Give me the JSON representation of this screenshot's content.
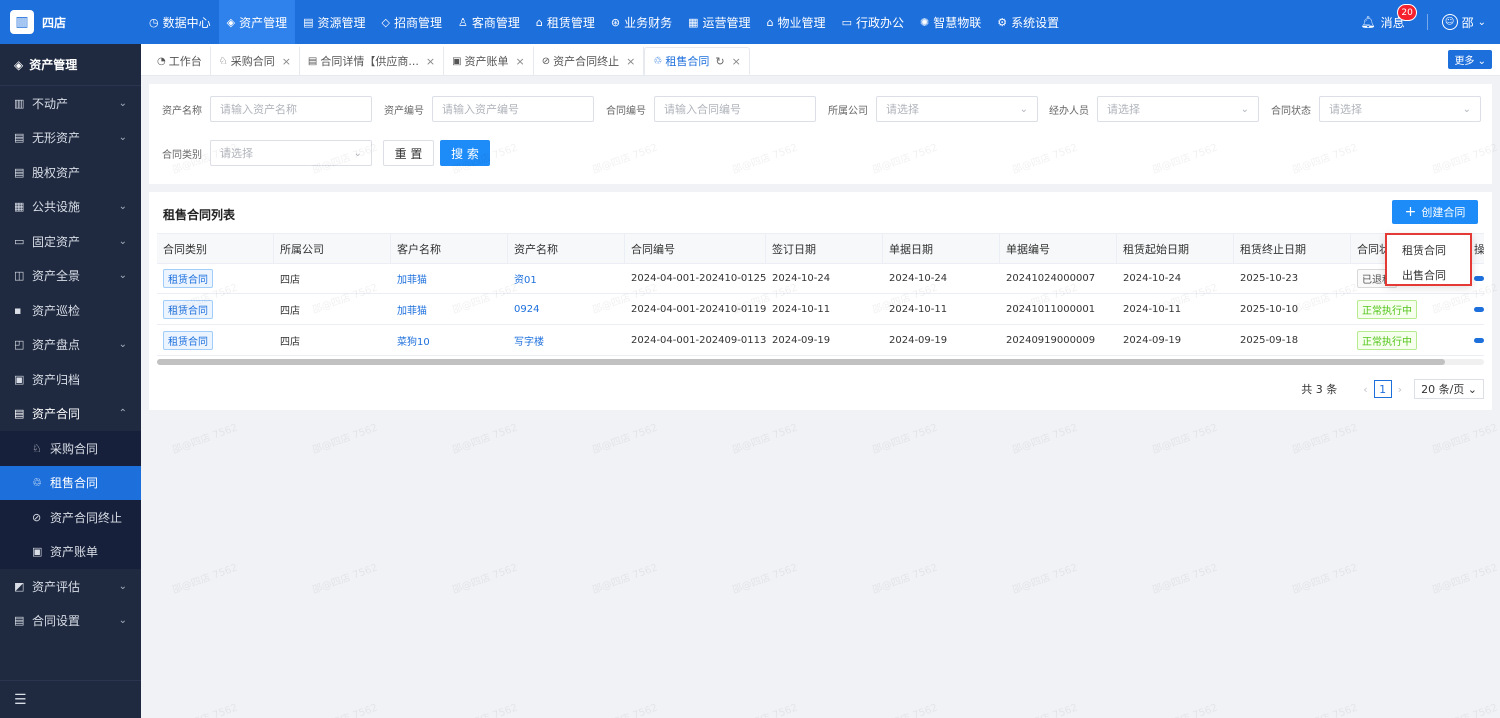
{
  "brand": {
    "name": "四店"
  },
  "topnav": [
    {
      "label": "数据中心",
      "icon": "dashboard-icon",
      "glyph": "◷"
    },
    {
      "label": "资产管理",
      "icon": "cube-icon",
      "glyph": "◈",
      "active": true
    },
    {
      "label": "资源管理",
      "icon": "building-icon",
      "glyph": "▤"
    },
    {
      "label": "招商管理",
      "icon": "tag-icon",
      "glyph": "◇"
    },
    {
      "label": "客商管理",
      "icon": "users-icon",
      "glyph": "♙"
    },
    {
      "label": "租赁管理",
      "icon": "house-icon",
      "glyph": "⌂"
    },
    {
      "label": "业务财务",
      "icon": "yen-icon",
      "glyph": "⊛"
    },
    {
      "label": "运营管理",
      "icon": "grid-icon",
      "glyph": "▦"
    },
    {
      "label": "物业管理",
      "icon": "home-icon",
      "glyph": "⌂"
    },
    {
      "label": "行政办公",
      "icon": "monitor-icon",
      "glyph": "▭"
    },
    {
      "label": "智慧物联",
      "icon": "iot-icon",
      "glyph": "✺"
    },
    {
      "label": "系统设置",
      "icon": "gear-icon",
      "glyph": "⚙"
    }
  ],
  "header_right": {
    "messages_label": "消息",
    "messages_count": "20",
    "user_name": "邵"
  },
  "sidebar": {
    "title": "资产管理",
    "items": [
      {
        "label": "不动产",
        "icon": "building-icon",
        "glyph": "▥",
        "chevron": "⌄"
      },
      {
        "label": "无形资产",
        "icon": "document-icon",
        "glyph": "▤",
        "chevron": "⌄"
      },
      {
        "label": "股权资产",
        "icon": "list-icon",
        "glyph": "▤",
        "chevron": ""
      },
      {
        "label": "公共设施",
        "icon": "facility-icon",
        "glyph": "▦",
        "chevron": "⌄"
      },
      {
        "label": "固定资产",
        "icon": "monitor-icon",
        "glyph": "▭",
        "chevron": "⌄"
      },
      {
        "label": "资产全景",
        "icon": "panorama-icon",
        "glyph": "◫",
        "chevron": "⌄"
      },
      {
        "label": "资产巡检",
        "icon": "inspect-icon",
        "glyph": "▪",
        "chevron": ""
      },
      {
        "label": "资产盘点",
        "icon": "inventory-icon",
        "glyph": "◰",
        "chevron": "⌄"
      },
      {
        "label": "资产归档",
        "icon": "archive-icon",
        "glyph": "▣",
        "chevron": ""
      },
      {
        "label": "资产合同",
        "icon": "contract-icon",
        "glyph": "▤",
        "chevron": "⌃",
        "open": true
      },
      {
        "label": "采购合同",
        "icon": "basket-icon",
        "glyph": "♘",
        "sub": true
      },
      {
        "label": "租售合同",
        "icon": "lease-icon",
        "glyph": "♲",
        "sub": true,
        "active": true
      },
      {
        "label": "资产合同终止",
        "icon": "stop-icon",
        "glyph": "⊘",
        "sub": true
      },
      {
        "label": "资产账单",
        "icon": "bill-icon",
        "glyph": "▣",
        "sub": true
      },
      {
        "label": "资产评估",
        "icon": "chart-icon",
        "glyph": "◩",
        "chevron": "⌄"
      },
      {
        "label": "合同设置",
        "icon": "settings-doc-icon",
        "glyph": "▤",
        "chevron": "⌄"
      }
    ]
  },
  "tabs": [
    {
      "label": "工作台",
      "icon": "workbench-icon",
      "glyph": "◔",
      "closable": false
    },
    {
      "label": "采购合同",
      "icon": "basket-icon",
      "glyph": "♘",
      "closable": true
    },
    {
      "label": "合同详情【供应商...",
      "icon": "detail-icon",
      "glyph": "▤",
      "closable": true
    },
    {
      "label": "资产账单",
      "icon": "bill-icon",
      "glyph": "▣",
      "closable": true
    },
    {
      "label": "资产合同终止",
      "icon": "stop-icon",
      "glyph": "⊘",
      "closable": true
    },
    {
      "label": "租售合同",
      "icon": "lease-icon",
      "glyph": "♲",
      "closable": true,
      "active": true
    }
  ],
  "more_label": "更多 ⌄",
  "search": {
    "asset_name": {
      "label": "资产名称",
      "placeholder": "请输入资产名称"
    },
    "asset_code": {
      "label": "资产编号",
      "placeholder": "请输入资产编号"
    },
    "contract_code": {
      "label": "合同编号",
      "placeholder": "请输入合同编号"
    },
    "company": {
      "label": "所属公司",
      "placeholder": "请选择"
    },
    "handler": {
      "label": "经办人员",
      "placeholder": "请选择"
    },
    "status": {
      "label": "合同状态",
      "placeholder": "请选择"
    },
    "category": {
      "label": "合同类别",
      "placeholder": "请选择"
    },
    "reset_label": "重 置",
    "search_label": "搜 索"
  },
  "list": {
    "title": "租售合同列表",
    "create_label": "创建合同",
    "columns": [
      "合同类别",
      "所属公司",
      "客户名称",
      "资产名称",
      "合同编号",
      "签订日期",
      "单据日期",
      "单据编号",
      "租赁起始日期",
      "租赁终止日期",
      "合同状态",
      "操"
    ],
    "rows": [
      {
        "category": "租赁合同",
        "company": "四店",
        "customer": "加菲猫",
        "asset": "资01",
        "contract_no": "2024-04-001-202410-0125",
        "sign_date": "2024-10-24",
        "doc_date": "2024-10-24",
        "doc_no": "20241024000007",
        "start": "2024-10-24",
        "end": "2025-10-23",
        "status": "已退租",
        "status_type": "off"
      },
      {
        "category": "租赁合同",
        "company": "四店",
        "customer": "加菲猫",
        "asset": "0924",
        "contract_no": "2024-04-001-202410-0119",
        "sign_date": "2024-10-11",
        "doc_date": "2024-10-11",
        "doc_no": "20241011000001",
        "start": "2024-10-11",
        "end": "2025-10-10",
        "status": "正常执行中",
        "status_type": "ok"
      },
      {
        "category": "租赁合同",
        "company": "四店",
        "customer": "菜狗10",
        "asset": "写字楼",
        "contract_no": "2024-04-001-202409-0113",
        "sign_date": "2024-09-19",
        "doc_date": "2024-09-19",
        "doc_no": "20240919000009",
        "start": "2024-09-19",
        "end": "2025-09-18",
        "status": "正常执行中",
        "status_type": "ok"
      }
    ]
  },
  "pagination": {
    "total": "共 3 条",
    "prev": "‹",
    "current": "1",
    "next": "›",
    "page_size": "20 条/页 ⌄"
  },
  "dropdown": {
    "options": [
      "租赁合同",
      "出售合同"
    ]
  },
  "watermark": "邵@四店 7562",
  "colors": {
    "primary": "#1d6fdc",
    "topbar": "#1d6fdc",
    "sidebar": "#1f2a40",
    "highlight_border": "#e53935"
  }
}
